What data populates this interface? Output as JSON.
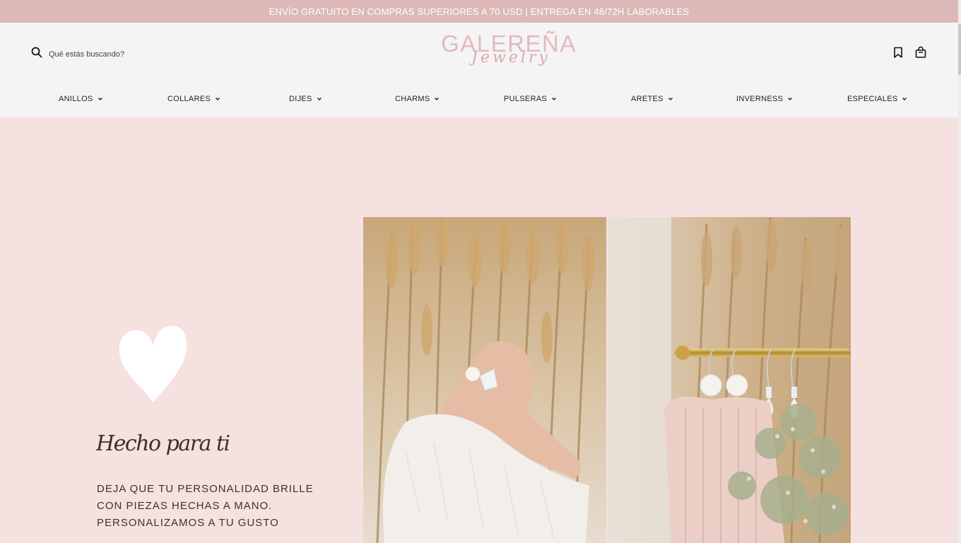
{
  "announcement": "ENVÍO GRATUITO EN COMPRAS SUPERIORES A 70 USD | ENTREGA EN 48/72H LABORABLES",
  "search": {
    "placeholder": "Qué estás buscando?"
  },
  "logo": {
    "main": "GALEREÑA",
    "sub": "Jewelry"
  },
  "nav": [
    {
      "label": "ANILLOS"
    },
    {
      "label": "COLLARES"
    },
    {
      "label": "DIJES"
    },
    {
      "label": "CHARMS"
    },
    {
      "label": "PULSERAS"
    },
    {
      "label": "ARETES"
    },
    {
      "label": "INVERNESS"
    },
    {
      "label": "ESPECIALES"
    }
  ],
  "hero": {
    "title": "Hecho para ti",
    "lines": [
      "DEJA QUE TU PERSONALIDAD BRILLE",
      "CON PIEZAS HECHAS A MANO.",
      "PERSONALIZAMOS A TU GUSTO"
    ]
  },
  "colors": {
    "announcement_bg": "#dcb9b7",
    "header_bg": "#f4f4f4",
    "page_bg": "#f5e1df",
    "logo": "#e5b8be"
  },
  "icons": [
    "search-icon",
    "bookmark-icon",
    "shopping-bag-icon",
    "chevron-down-icon",
    "heart-icon"
  ]
}
